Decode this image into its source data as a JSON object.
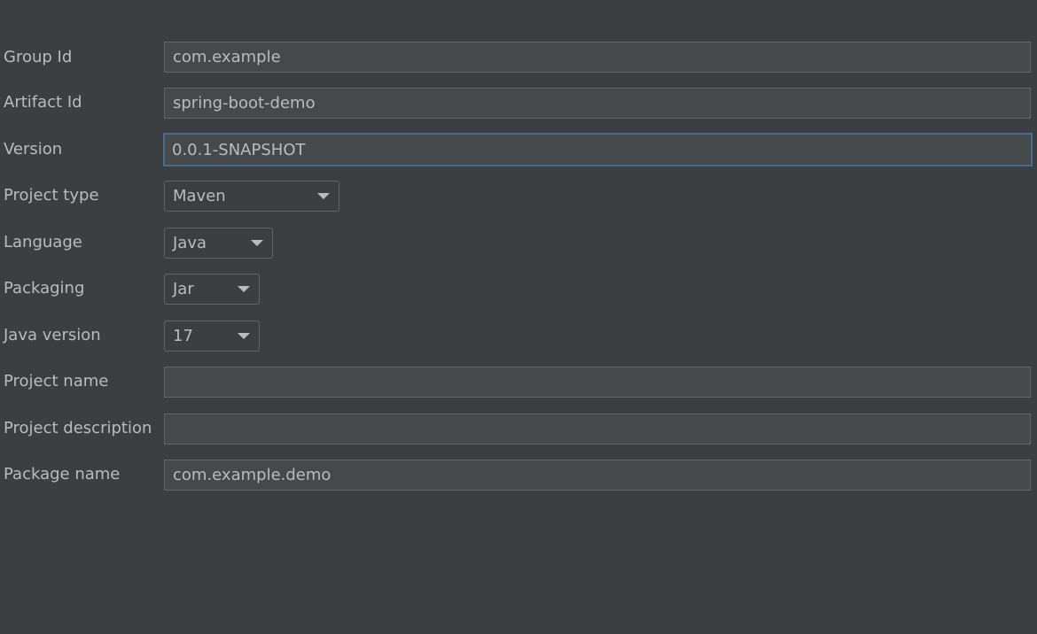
{
  "form": {
    "group_id": {
      "label": "Group Id",
      "value": "com.example"
    },
    "artifact_id": {
      "label": "Artifact Id",
      "value": "spring-boot-demo"
    },
    "version": {
      "label": "Version",
      "value": "0.0.1-SNAPSHOT"
    },
    "project_type": {
      "label": "Project type",
      "value": "Maven"
    },
    "language": {
      "label": "Language",
      "value": "Java"
    },
    "packaging": {
      "label": "Packaging",
      "value": "Jar"
    },
    "java_version": {
      "label": "Java version",
      "value": "17"
    },
    "project_name": {
      "label": "Project name",
      "value": ""
    },
    "project_description": {
      "label": "Project description",
      "value": ""
    },
    "package_name": {
      "label": "Package name",
      "value": "com.example.demo"
    }
  },
  "colors": {
    "background": "#3c3f41",
    "field_background": "#45494a",
    "field_border": "#646464",
    "focus_border": "#466d94",
    "text": "#bbbbbb"
  },
  "icons": {
    "combo_arrow": "chevron-down-icon"
  }
}
